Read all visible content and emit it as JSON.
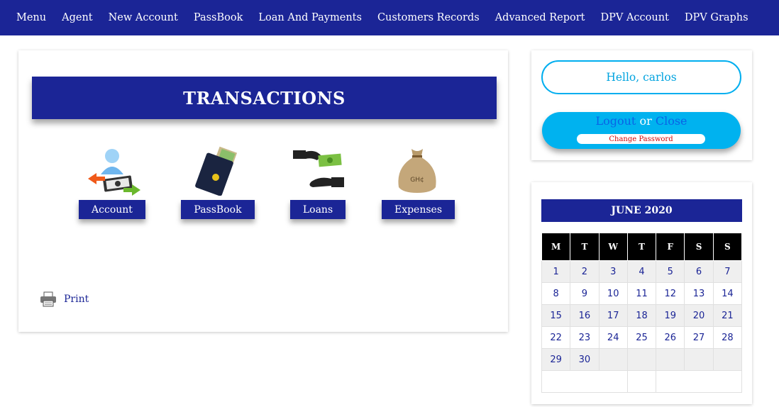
{
  "nav": {
    "items": [
      "Menu",
      "Agent",
      "New Account",
      "PassBook",
      "Loan And Payments",
      "Customers Records",
      "Advanced Report",
      "DPV Account",
      "DPV Graphs"
    ]
  },
  "transactions": {
    "title": "TRANSACTIONS",
    "tiles": [
      {
        "label": "Account",
        "icon": "account-transfer-icon"
      },
      {
        "label": "PassBook",
        "icon": "passbook-icon"
      },
      {
        "label": "Loans",
        "icon": "loan-hands-icon"
      },
      {
        "label": "Expenses",
        "icon": "money-bag-icon"
      }
    ],
    "money_bag_text": "GH¢",
    "print_label": "Print"
  },
  "user": {
    "greeting": "Hello, carlos",
    "logout_label": "Logout",
    "or_text": "or",
    "close_label": "Close",
    "change_password_label": "Change Password"
  },
  "calendar": {
    "title": "JUNE 2020",
    "weekdays": [
      "M",
      "T",
      "W",
      "T",
      "F",
      "S",
      "S"
    ],
    "weeks": [
      [
        "1",
        "2",
        "3",
        "4",
        "5",
        "6",
        "7"
      ],
      [
        "8",
        "9",
        "10",
        "11",
        "12",
        "13",
        "14"
      ],
      [
        "15",
        "16",
        "17",
        "18",
        "19",
        "20",
        "21"
      ],
      [
        "22",
        "23",
        "24",
        "25",
        "26",
        "27",
        "28"
      ],
      [
        "29",
        "30",
        "",
        "",
        "",
        "",
        ""
      ]
    ]
  },
  "colors": {
    "brand_navy": "#1b2596",
    "accent_cyan": "#00b2ef",
    "link_blue": "#0a63e6",
    "warning_red": "#d40000"
  }
}
